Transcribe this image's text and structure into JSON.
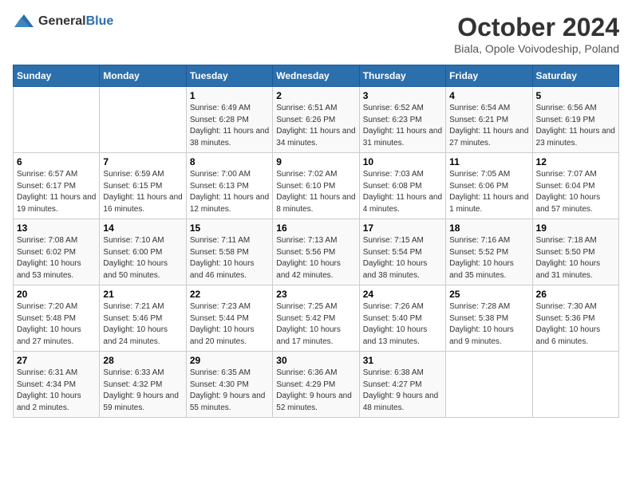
{
  "logo": {
    "text_general": "General",
    "text_blue": "Blue"
  },
  "title": "October 2024",
  "location": "Biala, Opole Voivodeship, Poland",
  "headers": [
    "Sunday",
    "Monday",
    "Tuesday",
    "Wednesday",
    "Thursday",
    "Friday",
    "Saturday"
  ],
  "weeks": [
    [
      {
        "day": "",
        "sunrise": "",
        "sunset": "",
        "daylight": ""
      },
      {
        "day": "",
        "sunrise": "",
        "sunset": "",
        "daylight": ""
      },
      {
        "day": "1",
        "sunrise": "Sunrise: 6:49 AM",
        "sunset": "Sunset: 6:28 PM",
        "daylight": "Daylight: 11 hours and 38 minutes."
      },
      {
        "day": "2",
        "sunrise": "Sunrise: 6:51 AM",
        "sunset": "Sunset: 6:26 PM",
        "daylight": "Daylight: 11 hours and 34 minutes."
      },
      {
        "day": "3",
        "sunrise": "Sunrise: 6:52 AM",
        "sunset": "Sunset: 6:23 PM",
        "daylight": "Daylight: 11 hours and 31 minutes."
      },
      {
        "day": "4",
        "sunrise": "Sunrise: 6:54 AM",
        "sunset": "Sunset: 6:21 PM",
        "daylight": "Daylight: 11 hours and 27 minutes."
      },
      {
        "day": "5",
        "sunrise": "Sunrise: 6:56 AM",
        "sunset": "Sunset: 6:19 PM",
        "daylight": "Daylight: 11 hours and 23 minutes."
      }
    ],
    [
      {
        "day": "6",
        "sunrise": "Sunrise: 6:57 AM",
        "sunset": "Sunset: 6:17 PM",
        "daylight": "Daylight: 11 hours and 19 minutes."
      },
      {
        "day": "7",
        "sunrise": "Sunrise: 6:59 AM",
        "sunset": "Sunset: 6:15 PM",
        "daylight": "Daylight: 11 hours and 16 minutes."
      },
      {
        "day": "8",
        "sunrise": "Sunrise: 7:00 AM",
        "sunset": "Sunset: 6:13 PM",
        "daylight": "Daylight: 11 hours and 12 minutes."
      },
      {
        "day": "9",
        "sunrise": "Sunrise: 7:02 AM",
        "sunset": "Sunset: 6:10 PM",
        "daylight": "Daylight: 11 hours and 8 minutes."
      },
      {
        "day": "10",
        "sunrise": "Sunrise: 7:03 AM",
        "sunset": "Sunset: 6:08 PM",
        "daylight": "Daylight: 11 hours and 4 minutes."
      },
      {
        "day": "11",
        "sunrise": "Sunrise: 7:05 AM",
        "sunset": "Sunset: 6:06 PM",
        "daylight": "Daylight: 11 hours and 1 minute."
      },
      {
        "day": "12",
        "sunrise": "Sunrise: 7:07 AM",
        "sunset": "Sunset: 6:04 PM",
        "daylight": "Daylight: 10 hours and 57 minutes."
      }
    ],
    [
      {
        "day": "13",
        "sunrise": "Sunrise: 7:08 AM",
        "sunset": "Sunset: 6:02 PM",
        "daylight": "Daylight: 10 hours and 53 minutes."
      },
      {
        "day": "14",
        "sunrise": "Sunrise: 7:10 AM",
        "sunset": "Sunset: 6:00 PM",
        "daylight": "Daylight: 10 hours and 50 minutes."
      },
      {
        "day": "15",
        "sunrise": "Sunrise: 7:11 AM",
        "sunset": "Sunset: 5:58 PM",
        "daylight": "Daylight: 10 hours and 46 minutes."
      },
      {
        "day": "16",
        "sunrise": "Sunrise: 7:13 AM",
        "sunset": "Sunset: 5:56 PM",
        "daylight": "Daylight: 10 hours and 42 minutes."
      },
      {
        "day": "17",
        "sunrise": "Sunrise: 7:15 AM",
        "sunset": "Sunset: 5:54 PM",
        "daylight": "Daylight: 10 hours and 38 minutes."
      },
      {
        "day": "18",
        "sunrise": "Sunrise: 7:16 AM",
        "sunset": "Sunset: 5:52 PM",
        "daylight": "Daylight: 10 hours and 35 minutes."
      },
      {
        "day": "19",
        "sunrise": "Sunrise: 7:18 AM",
        "sunset": "Sunset: 5:50 PM",
        "daylight": "Daylight: 10 hours and 31 minutes."
      }
    ],
    [
      {
        "day": "20",
        "sunrise": "Sunrise: 7:20 AM",
        "sunset": "Sunset: 5:48 PM",
        "daylight": "Daylight: 10 hours and 27 minutes."
      },
      {
        "day": "21",
        "sunrise": "Sunrise: 7:21 AM",
        "sunset": "Sunset: 5:46 PM",
        "daylight": "Daylight: 10 hours and 24 minutes."
      },
      {
        "day": "22",
        "sunrise": "Sunrise: 7:23 AM",
        "sunset": "Sunset: 5:44 PM",
        "daylight": "Daylight: 10 hours and 20 minutes."
      },
      {
        "day": "23",
        "sunrise": "Sunrise: 7:25 AM",
        "sunset": "Sunset: 5:42 PM",
        "daylight": "Daylight: 10 hours and 17 minutes."
      },
      {
        "day": "24",
        "sunrise": "Sunrise: 7:26 AM",
        "sunset": "Sunset: 5:40 PM",
        "daylight": "Daylight: 10 hours and 13 minutes."
      },
      {
        "day": "25",
        "sunrise": "Sunrise: 7:28 AM",
        "sunset": "Sunset: 5:38 PM",
        "daylight": "Daylight: 10 hours and 9 minutes."
      },
      {
        "day": "26",
        "sunrise": "Sunrise: 7:30 AM",
        "sunset": "Sunset: 5:36 PM",
        "daylight": "Daylight: 10 hours and 6 minutes."
      }
    ],
    [
      {
        "day": "27",
        "sunrise": "Sunrise: 6:31 AM",
        "sunset": "Sunset: 4:34 PM",
        "daylight": "Daylight: 10 hours and 2 minutes."
      },
      {
        "day": "28",
        "sunrise": "Sunrise: 6:33 AM",
        "sunset": "Sunset: 4:32 PM",
        "daylight": "Daylight: 9 hours and 59 minutes."
      },
      {
        "day": "29",
        "sunrise": "Sunrise: 6:35 AM",
        "sunset": "Sunset: 4:30 PM",
        "daylight": "Daylight: 9 hours and 55 minutes."
      },
      {
        "day": "30",
        "sunrise": "Sunrise: 6:36 AM",
        "sunset": "Sunset: 4:29 PM",
        "daylight": "Daylight: 9 hours and 52 minutes."
      },
      {
        "day": "31",
        "sunrise": "Sunrise: 6:38 AM",
        "sunset": "Sunset: 4:27 PM",
        "daylight": "Daylight: 9 hours and 48 minutes."
      },
      {
        "day": "",
        "sunrise": "",
        "sunset": "",
        "daylight": ""
      },
      {
        "day": "",
        "sunrise": "",
        "sunset": "",
        "daylight": ""
      }
    ]
  ]
}
